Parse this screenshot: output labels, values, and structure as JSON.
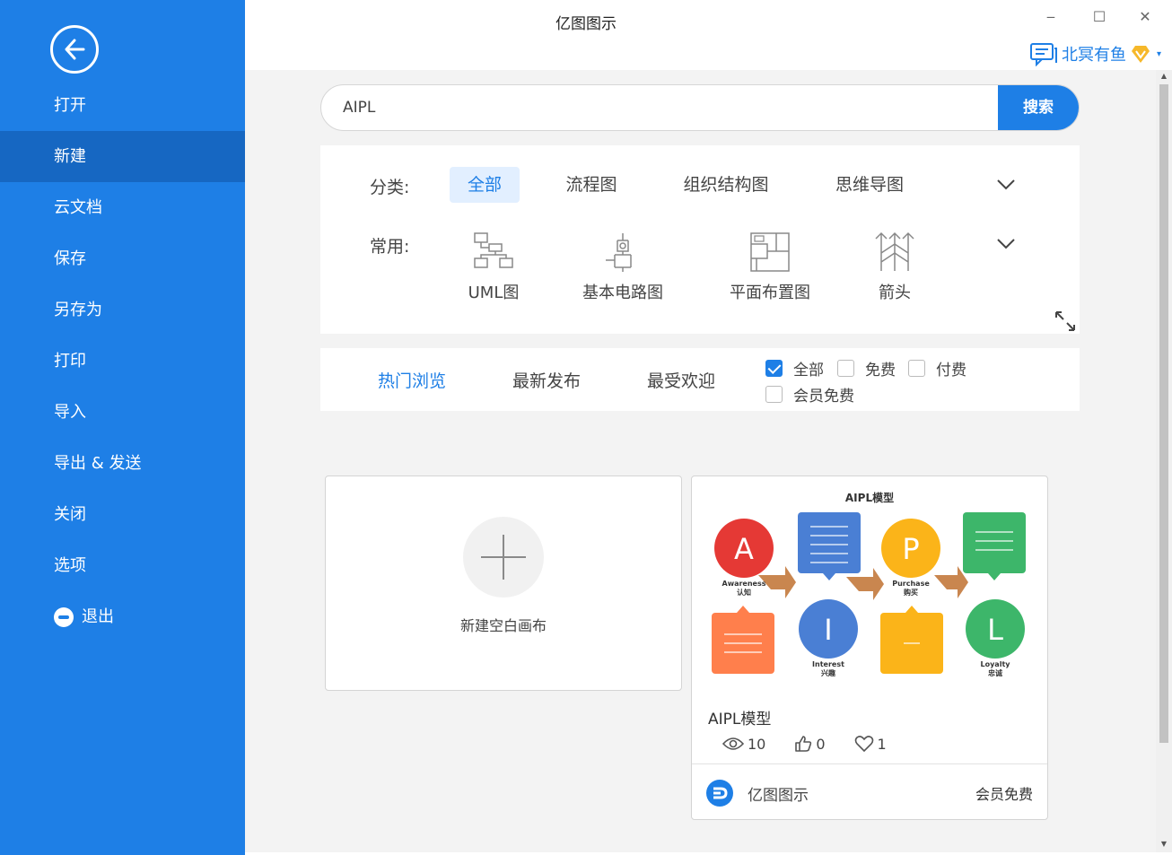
{
  "window": {
    "title": "亿图图示",
    "minimize": "‒",
    "maximize": "☐",
    "close": "✕"
  },
  "user": {
    "name": "北冥有鱼",
    "icon": "chat-icon",
    "vip_icon": "vip-diamond-icon",
    "caret": "▾"
  },
  "sidebar": {
    "items": [
      {
        "label": "打开"
      },
      {
        "label": "新建"
      },
      {
        "label": "云文档"
      },
      {
        "label": "保存"
      },
      {
        "label": "另存为"
      },
      {
        "label": "打印"
      },
      {
        "label": "导入"
      },
      {
        "label": "导出 & 发送"
      },
      {
        "label": "关闭"
      },
      {
        "label": "选项"
      },
      {
        "label": "退出"
      }
    ],
    "active": "新建"
  },
  "search": {
    "value": "AIPL",
    "button": "搜索"
  },
  "filters": {
    "category_label": "分类:",
    "categories": [
      "全部",
      "流程图",
      "组织结构图",
      "思维导图"
    ],
    "common_label": "常用:",
    "common": [
      "UML图",
      "基本电路图",
      "平面布置图",
      "箭头"
    ]
  },
  "sort": {
    "tabs": [
      "热门浏览",
      "最新发布",
      "最受欢迎"
    ],
    "checks": [
      {
        "label": "全部",
        "checked": true
      },
      {
        "label": "免费",
        "checked": false
      },
      {
        "label": "付费",
        "checked": false
      },
      {
        "label": "会员免费",
        "checked": false
      }
    ]
  },
  "new_blank": {
    "label": "新建空白画布"
  },
  "template": {
    "thumb_title": "AIPL模型",
    "name": "AIPL模型",
    "views": "10",
    "likes": "0",
    "favorites": "1",
    "author": "亿图图示",
    "badge": "会员免费",
    "thumb": {
      "letters": [
        "A",
        "I",
        "P",
        "L"
      ],
      "captions": [
        "Awareness",
        "Interest",
        "Purchase",
        "Loyalty"
      ],
      "captions_cn": [
        "认知",
        "兴趣",
        "购买",
        "忠诚"
      ],
      "colors": {
        "A": "#e53935",
        "I": "#4a7fd4",
        "P": "#fbb419",
        "L": "#3db66a",
        "orange": "#ff7f4c",
        "blue_box": "#4a7fd4",
        "green_box": "#3db66a",
        "yellow_box": "#fbb419",
        "arrow": "#c9864f"
      }
    }
  },
  "colors": {
    "accent": "#1e7fe6",
    "sidebar_active": "#1667c2",
    "chip_bg": "#e2efff"
  }
}
